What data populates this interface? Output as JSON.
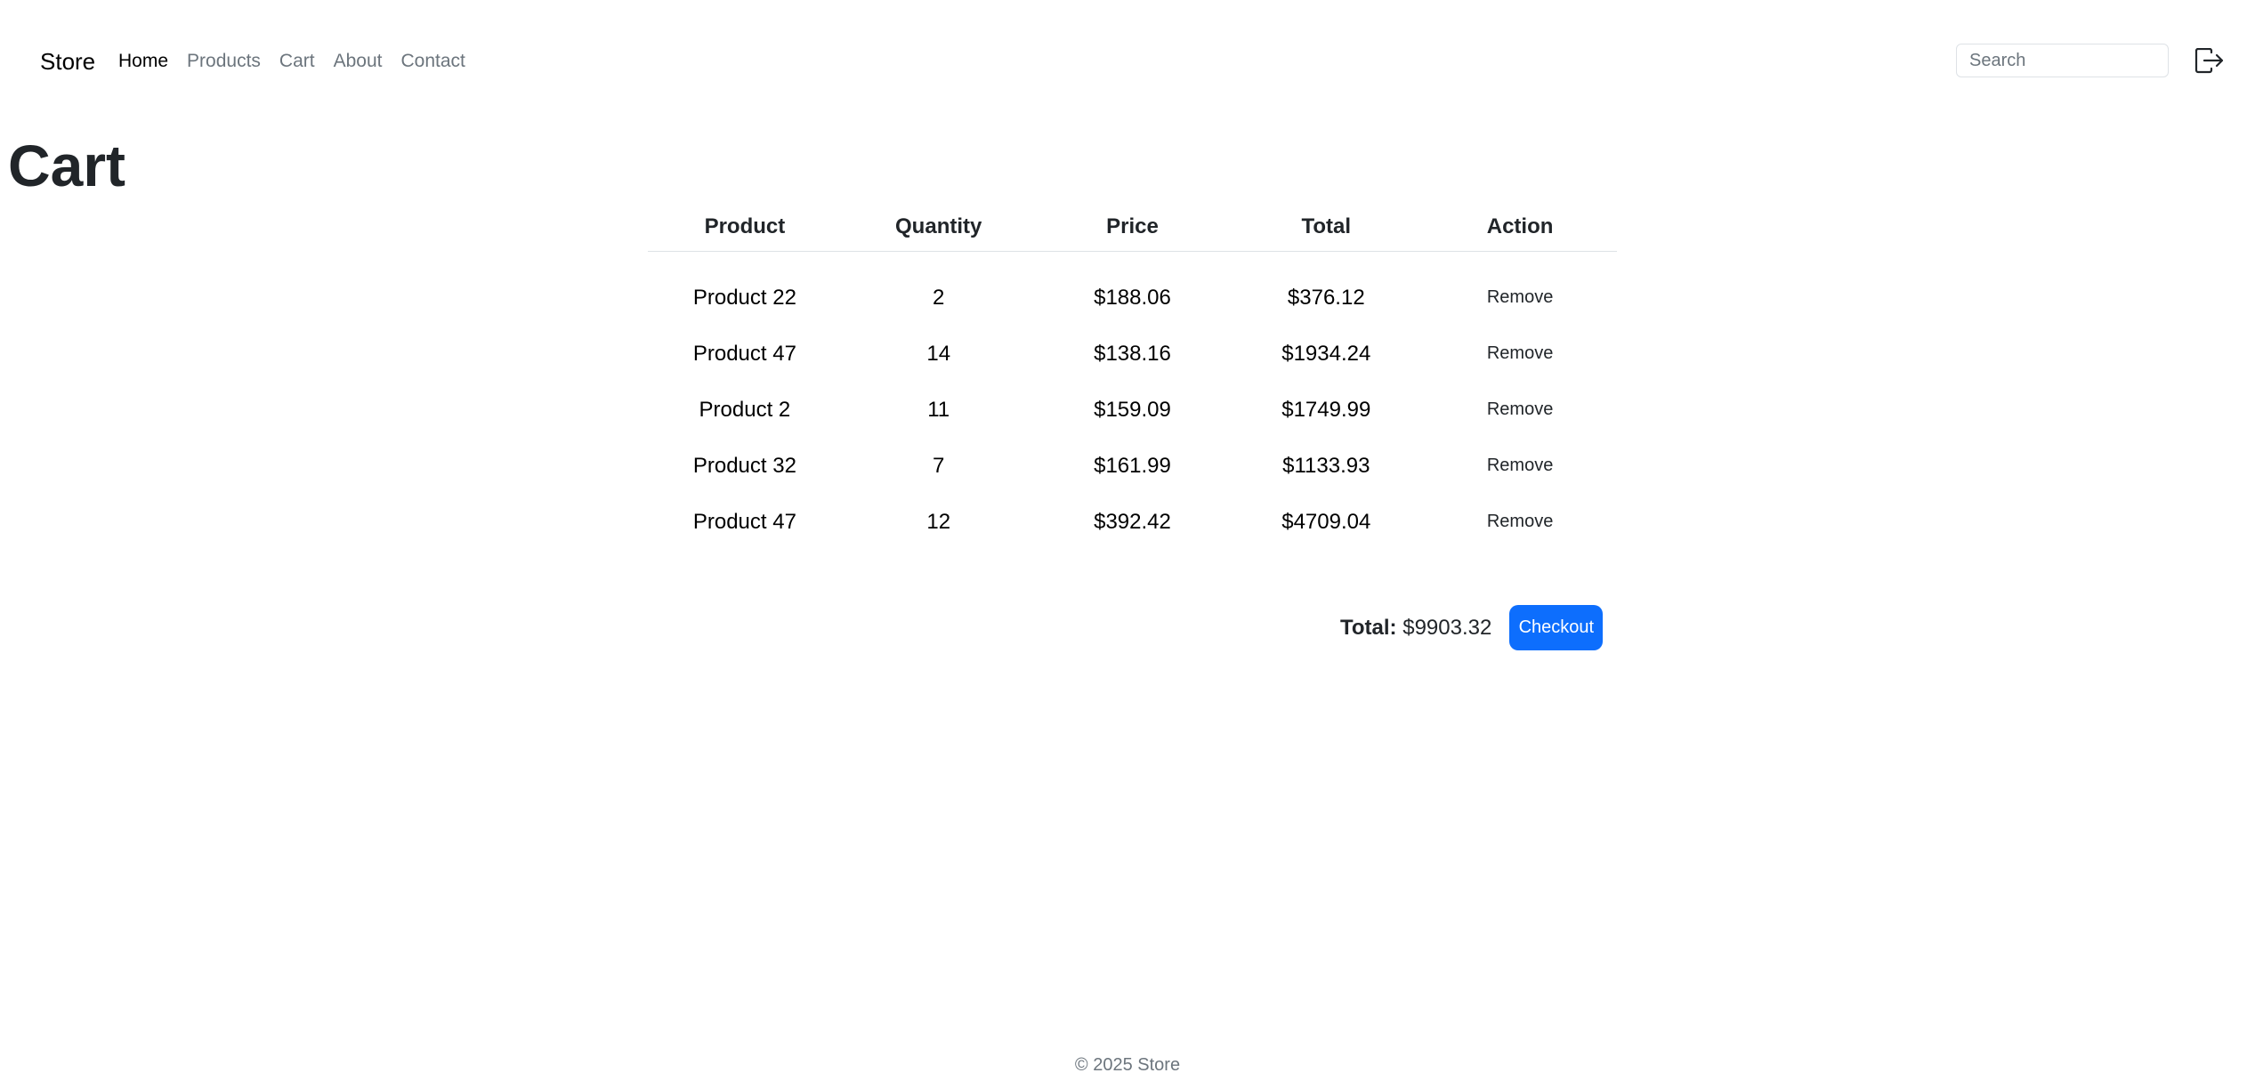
{
  "navbar": {
    "brand": "Store",
    "links": [
      {
        "label": "Home",
        "active": true
      },
      {
        "label": "Products",
        "active": false
      },
      {
        "label": "Cart",
        "active": false
      },
      {
        "label": "About",
        "active": false
      },
      {
        "label": "Contact",
        "active": false
      }
    ],
    "search_placeholder": "Search",
    "logout_icon": "logout-icon"
  },
  "page": {
    "title": "Cart"
  },
  "table": {
    "headers": [
      "Product",
      "Quantity",
      "Price",
      "Total",
      "Action"
    ],
    "rows": [
      {
        "product": "Product 22",
        "quantity": "2",
        "price": "$188.06",
        "total": "$376.12",
        "action": "Remove"
      },
      {
        "product": "Product 47",
        "quantity": "14",
        "price": "$138.16",
        "total": "$1934.24",
        "action": "Remove"
      },
      {
        "product": "Product 2",
        "quantity": "11",
        "price": "$159.09",
        "total": "$1749.99",
        "action": "Remove"
      },
      {
        "product": "Product 32",
        "quantity": "7",
        "price": "$161.99",
        "total": "$1133.93",
        "action": "Remove"
      },
      {
        "product": "Product 47",
        "quantity": "12",
        "price": "$392.42",
        "total": "$4709.04",
        "action": "Remove"
      }
    ]
  },
  "summary": {
    "total_label": "Total:",
    "total_value": "$9903.32",
    "checkout_label": "Checkout"
  },
  "footer": {
    "text": "© 2025 Store"
  },
  "colors": {
    "primary": "#0d6efd",
    "muted": "#6c757d",
    "text": "#212529"
  }
}
